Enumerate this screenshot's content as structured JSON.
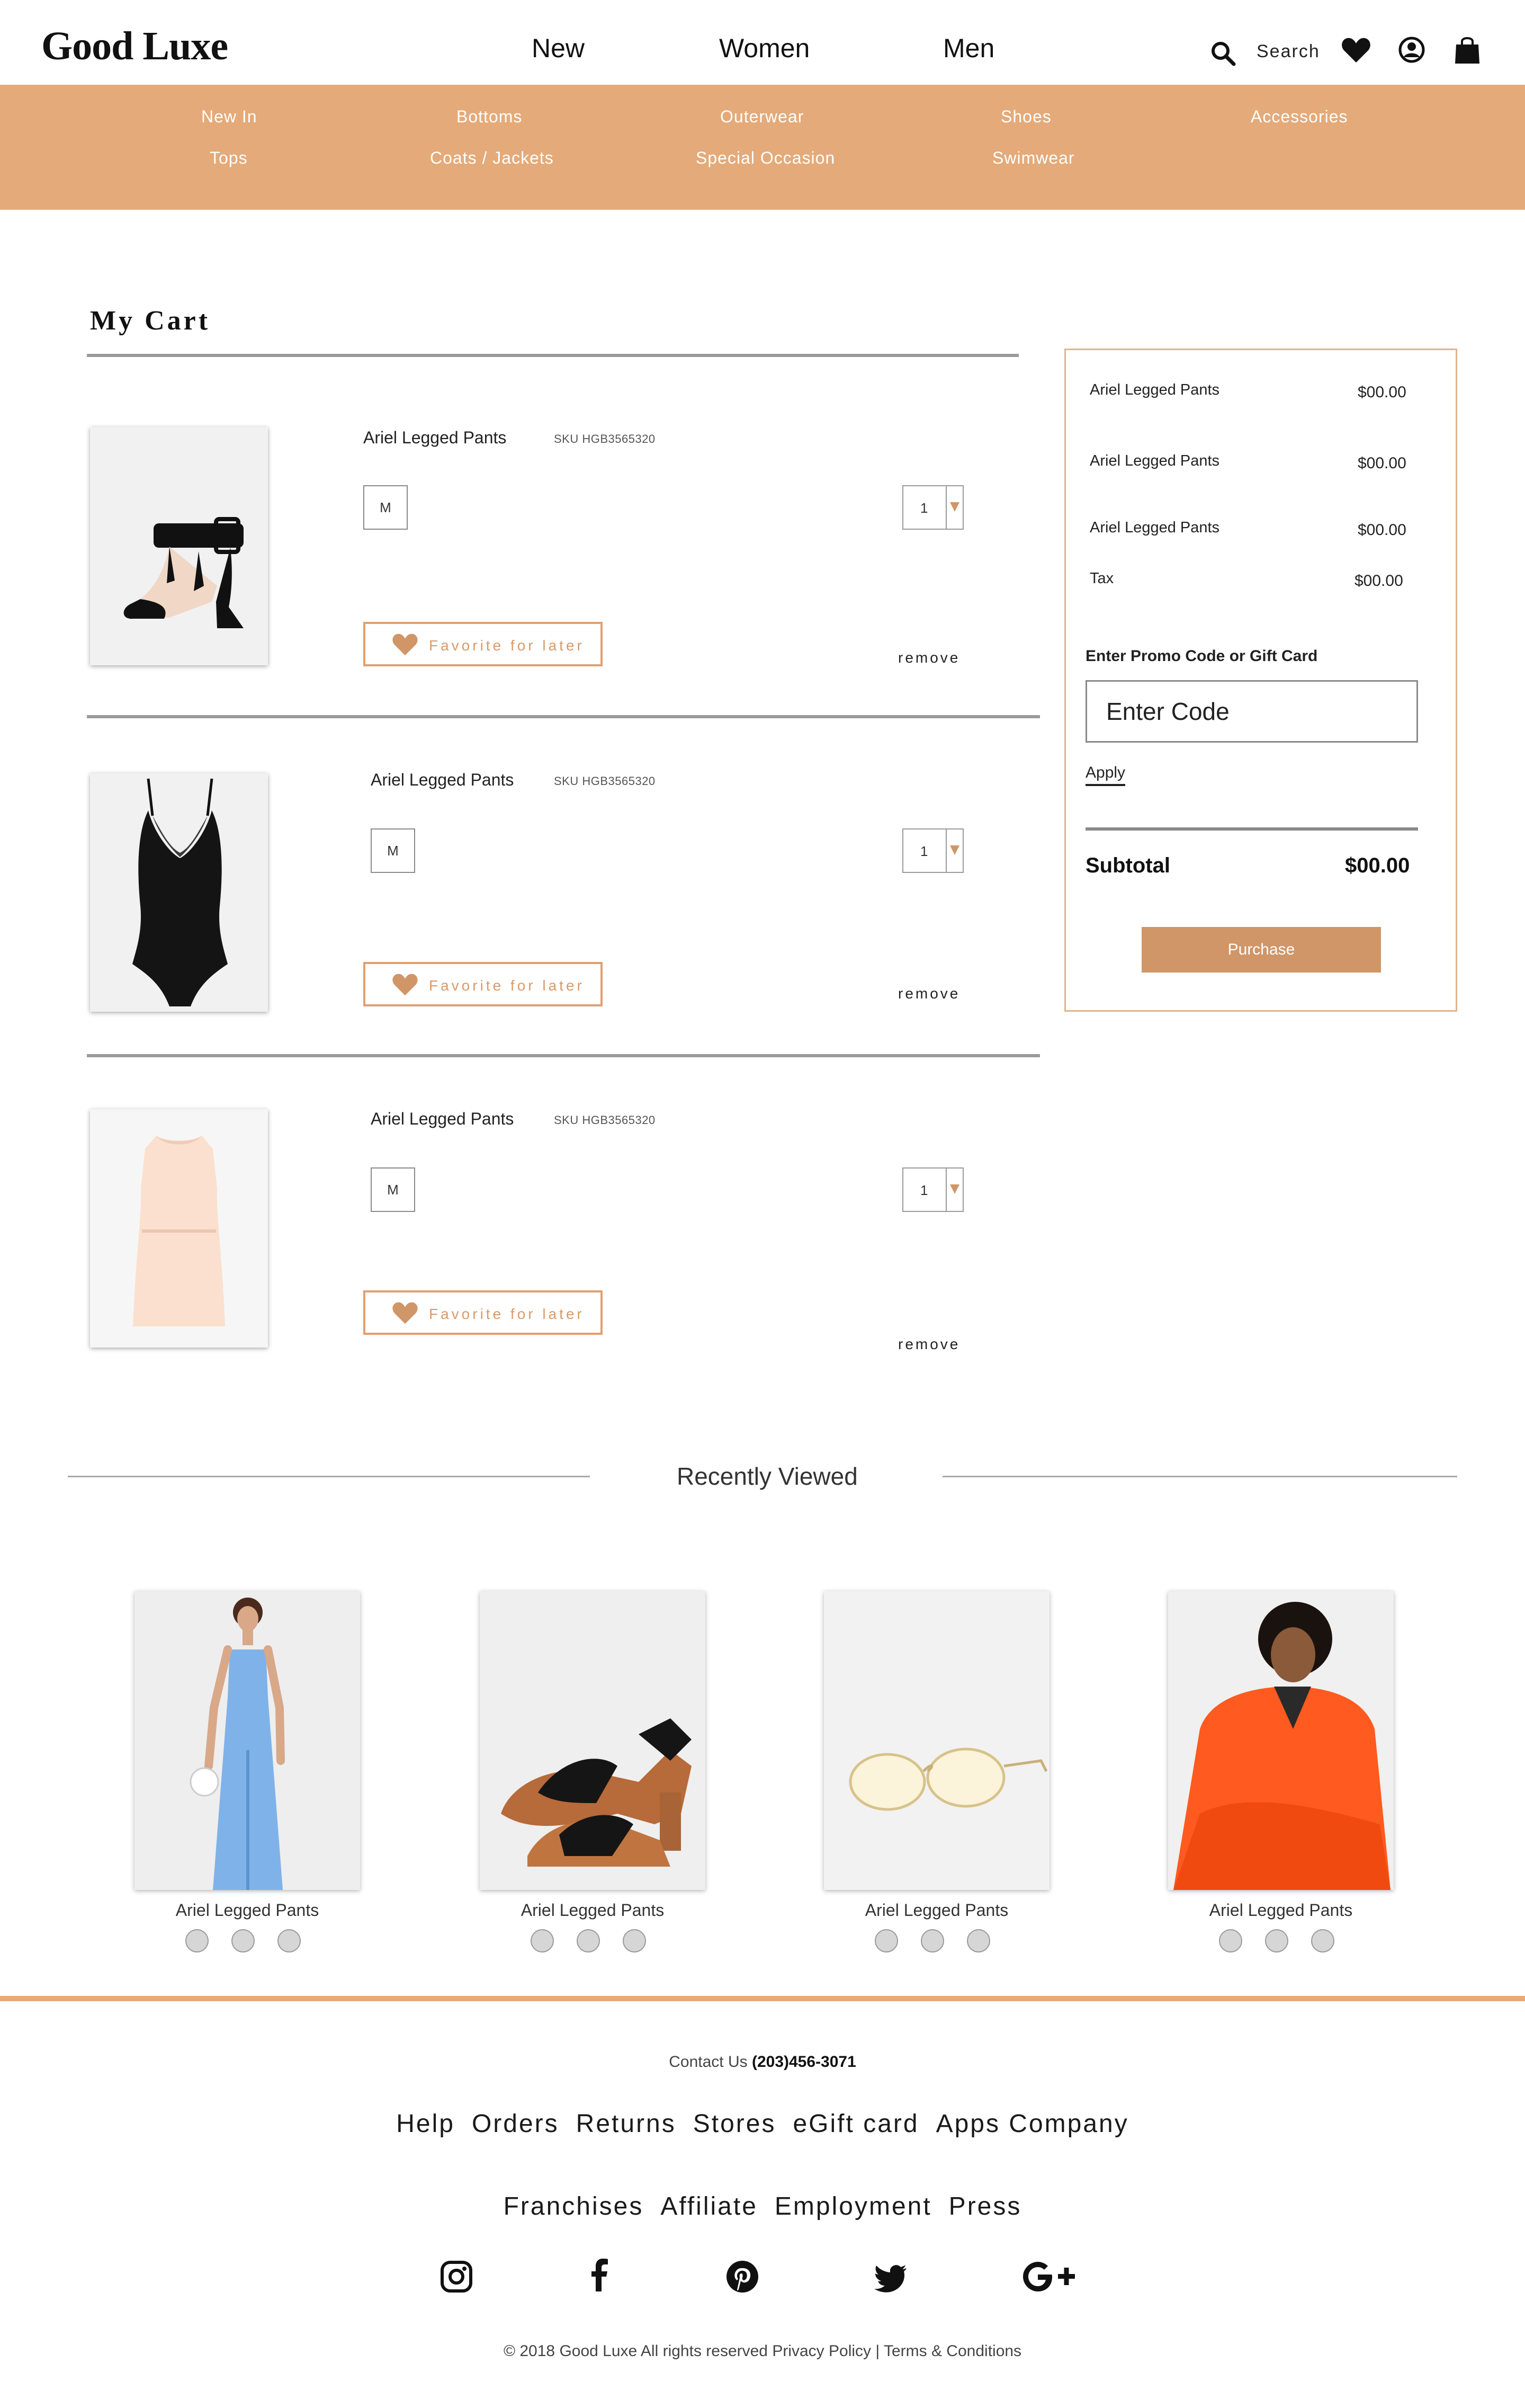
{
  "header": {
    "logo": "Good Luxe",
    "nav": [
      "New",
      "Women",
      "Men"
    ],
    "search_label": "Search"
  },
  "categories": {
    "row1": [
      "New In",
      "Bottoms",
      "Outerwear",
      "Shoes",
      "Accessories"
    ],
    "row2": [
      "Tops",
      "Coats / Jackets",
      "Special Occasion",
      "Swimwear"
    ]
  },
  "cart": {
    "title": "My Cart",
    "items": [
      {
        "name": "Ariel Legged Pants",
        "sku": "SKU HGB3565320",
        "size": "M",
        "qty": "1",
        "favorite_label": "Favorite for later",
        "remove_label": "remove",
        "image": "black-heeled-sandal"
      },
      {
        "name": "Ariel Legged Pants",
        "sku": "SKU HGB3565320",
        "size": "M",
        "qty": "1",
        "favorite_label": "Favorite for later",
        "remove_label": "remove",
        "image": "black-lace-bodysuit"
      },
      {
        "name": "Ariel Legged Pants",
        "sku": "SKU HGB3565320",
        "size": "M",
        "qty": "1",
        "favorite_label": "Favorite for later",
        "remove_label": "remove",
        "image": "peach-dress"
      }
    ]
  },
  "summary": {
    "lines": [
      {
        "label": "Ariel Legged Pants",
        "value": "$00.00"
      },
      {
        "label": "Ariel Legged Pants",
        "value": "$00.00"
      },
      {
        "label": "Ariel Legged Pants",
        "value": "$00.00"
      },
      {
        "label": "Tax",
        "value": "$00.00"
      }
    ],
    "promo_label": "Enter Promo Code or Gift Card",
    "promo_placeholder": "Enter Code",
    "apply_label": "Apply",
    "subtotal_label": "Subtotal",
    "subtotal_value": "$00.00",
    "purchase_label": "Purchase"
  },
  "recently_viewed": {
    "title": "Recently Viewed",
    "items": [
      {
        "name": "Ariel Legged Pants",
        "image": "blue-jumpsuit"
      },
      {
        "name": "Ariel Legged Pants",
        "image": "black-block-sandal"
      },
      {
        "name": "Ariel Legged Pants",
        "image": "aviator-sunglasses"
      },
      {
        "name": "Ariel Legged Pants",
        "image": "orange-jacket"
      }
    ]
  },
  "footer": {
    "contact_label": "Contact Us",
    "contact_phone": "(203)456-3071",
    "links_row1": [
      "Help",
      "Orders",
      "Returns",
      "Stores",
      "eGift card",
      "Apps Company"
    ],
    "links_row2": [
      "Franchises",
      "Affiliate",
      "Employment",
      "Press"
    ],
    "social": [
      "instagram-icon",
      "facebook-icon",
      "pinterest-icon",
      "twitter-icon",
      "google-plus-icon"
    ],
    "copyright": "© 2018 Good Luxe All rights reserved Privacy Policy | Terms & Conditions"
  },
  "colors": {
    "accent": "#e4aa79",
    "button": "#d09668",
    "favorite": "#d99a68"
  }
}
